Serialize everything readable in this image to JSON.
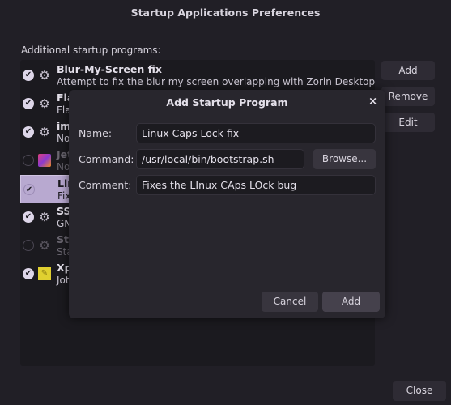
{
  "window": {
    "title": "Startup Applications Preferences"
  },
  "list_label": "Additional startup programs:",
  "programs": [
    {
      "name": "Blur-My-Screen fix",
      "comment": "Attempt to fix the blur my screen overlapping with Zorin Desktop",
      "enabled": true,
      "icon": "gear-icon"
    },
    {
      "name": "Fla",
      "comment": "Fla",
      "enabled": true,
      "icon": "gear-icon"
    },
    {
      "name": "im-",
      "comment": "No",
      "enabled": true,
      "icon": "gear-icon"
    },
    {
      "name": "Jet",
      "comment": "No",
      "enabled": false,
      "icon": "jetbrains-icon"
    },
    {
      "name": "Lin",
      "comment": "Fix",
      "enabled": true,
      "icon": "none",
      "selected": true
    },
    {
      "name": "SS",
      "comment": "GN",
      "enabled": true,
      "icon": "gear-icon"
    },
    {
      "name": "Sta",
      "comment": "Sta",
      "enabled": false,
      "icon": "gear-icon"
    },
    {
      "name": "Xp",
      "comment": "Jot",
      "enabled": true,
      "icon": "note-icon"
    }
  ],
  "buttons": {
    "add": "Add",
    "remove": "Remove",
    "edit": "Edit",
    "close": "Close"
  },
  "dialog": {
    "title": "Add Startup Program",
    "close": "×",
    "name_label": "Name:",
    "name_value": "Linux Caps Lock fix",
    "command_label": "Command:",
    "command_value": "/usr/local/bin/bootstrap.sh",
    "browse": "Browse...",
    "comment_label": "Comment:",
    "comment_value": "Fixes the LInux CAps LOck bug",
    "cancel": "Cancel",
    "add": "Add"
  }
}
